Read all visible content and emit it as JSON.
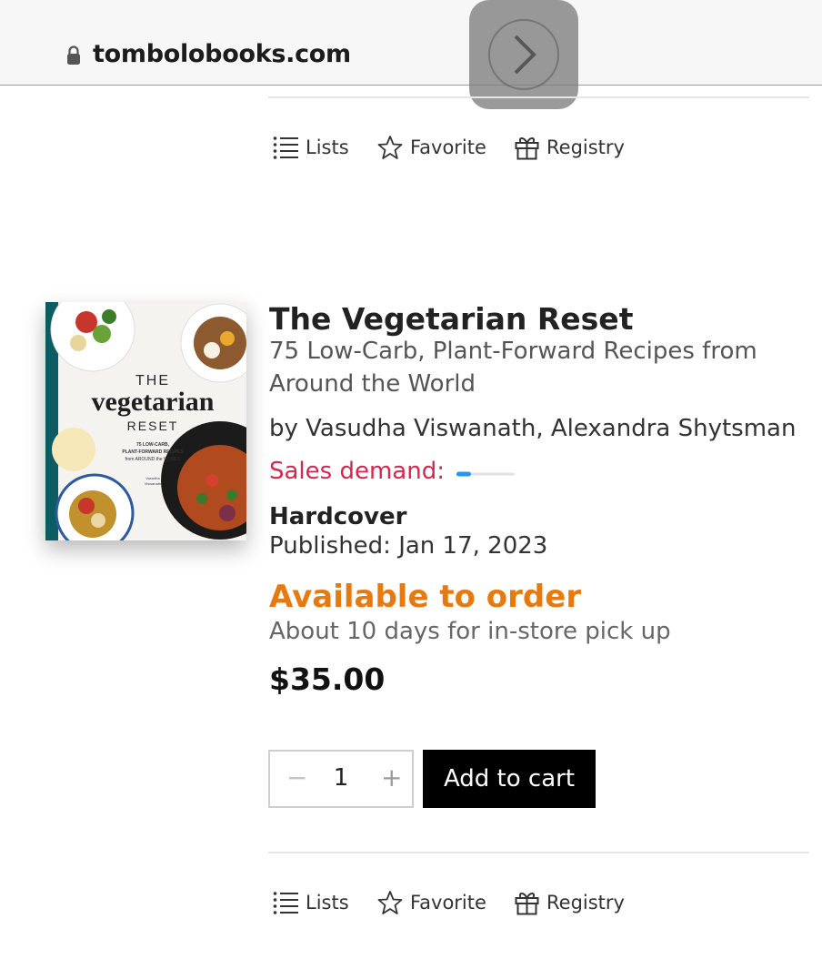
{
  "browser": {
    "url": "tombolobooks.com"
  },
  "actions": {
    "lists_label": "Lists",
    "favorite_label": "Favorite",
    "registry_label": "Registry"
  },
  "book": {
    "title": "The Vegetarian Reset",
    "subtitle": "75 Low-Carb, Plant-Forward Recipes from Around the World",
    "authors": "by Vasudha Viswanath, Alexandra Shytsman",
    "sales_demand_label": "Sales demand:",
    "sales_demand_level": 0.25,
    "format": "Hardcover",
    "published": "Published: Jan 17, 2023",
    "availability": "Available to order",
    "pickup_note": "About 10 days for in-store pick up",
    "price": "$35.00",
    "cover": {
      "line1": "THE",
      "line2": "vegetarian",
      "line3": "RESET",
      "blurb1": "75 LOW-CARB,",
      "blurb2": "PLANT-FORWARD RECIPES",
      "blurb3": "from AROUND the WORLD",
      "author1": "Vasudha",
      "author2": "Viswanath"
    }
  },
  "cart": {
    "minus": "−",
    "quantity": "1",
    "plus": "+",
    "add_label": "Add to cart"
  },
  "colors": {
    "demand": "#d6264e",
    "availability": "#e6790f",
    "cover_spine": "#0d5b63"
  }
}
